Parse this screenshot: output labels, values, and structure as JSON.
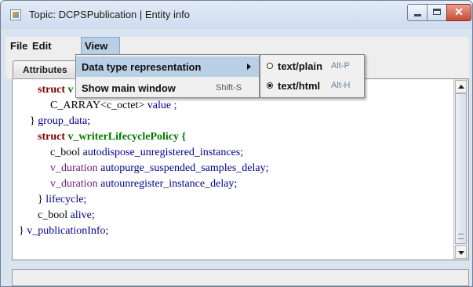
{
  "window": {
    "title": "Topic: DCPSPublication | Entity info",
    "controls": [
      "minimize-icon",
      "maximize-icon",
      "close-icon"
    ]
  },
  "menubar": {
    "file": "File",
    "edit": "Edit",
    "view": "View"
  },
  "tabs": [
    {
      "label": "Attributes"
    }
  ],
  "view_menu": {
    "items": [
      {
        "label": "Data type representation",
        "shortcut": "",
        "has_submenu": true
      },
      {
        "label": "Show main window",
        "shortcut": "Shift-S"
      }
    ]
  },
  "submenu": {
    "items": [
      {
        "label": "text/plain",
        "shortcut": "Alt-P",
        "selected": false
      },
      {
        "label": "text/html",
        "shortcut": "Alt-H",
        "selected": true
      }
    ]
  },
  "code": {
    "l1_kw": "struct",
    "l1_rest": "v",
    "l2_type": "C_ARRAY<c_octet>",
    "l2_field": "value ;",
    "l3_close": "}",
    "l3_name": "group_data;",
    "l4_kw": "struct",
    "l4_name": "v_writerLifecyclePolicy {",
    "l5_type": "c_bool",
    "l5_field": "autodispose_unregistered_instances;",
    "l6_type": "v_duration",
    "l6_field": "autopurge_suspended_samples_delay;",
    "l7_type": "v_duration",
    "l7_field": "autounregister_instance_delay;",
    "l8_close": "}",
    "l8_name": "lifecycle;",
    "l9_type": "c_bool",
    "l9_field": "alive;",
    "l10_close": "}",
    "l10_name": "v_publicationInfo;"
  },
  "status": {
    "text": ""
  }
}
